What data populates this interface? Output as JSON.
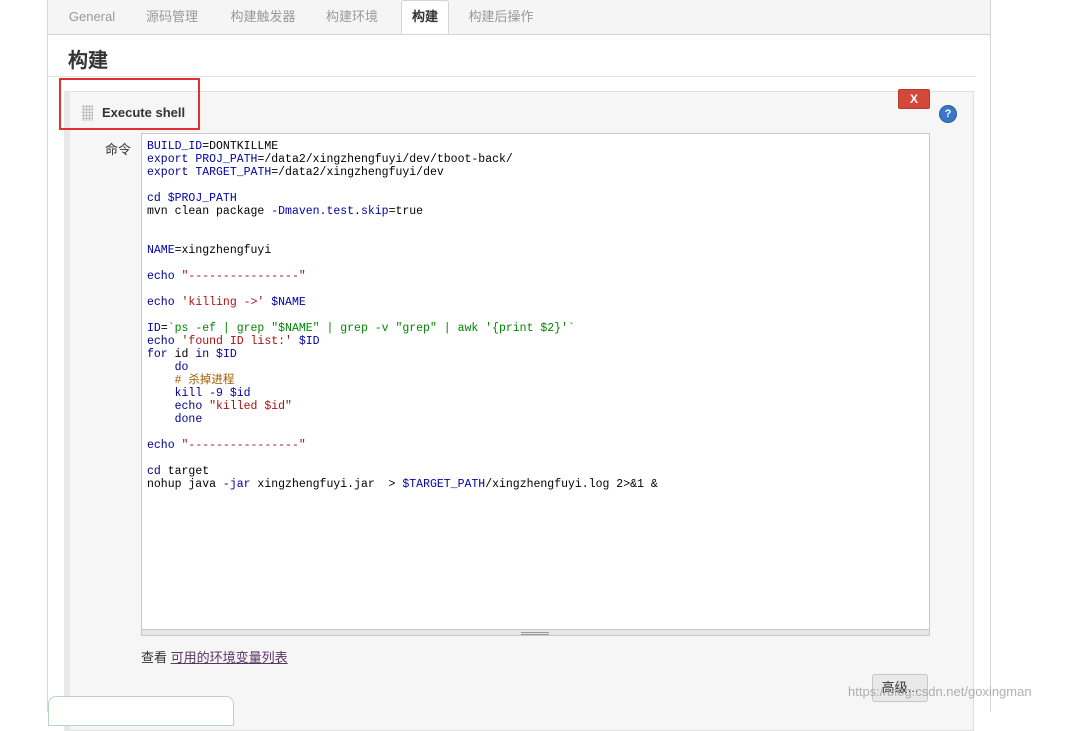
{
  "tabs": [
    {
      "label": "General"
    },
    {
      "label": "源码管理"
    },
    {
      "label": "构建触发器"
    },
    {
      "label": "构建环境"
    },
    {
      "label": "构建"
    },
    {
      "label": "构建后操作"
    }
  ],
  "active_tab": "构建",
  "section": {
    "title": "构建"
  },
  "step": {
    "title": "Execute shell",
    "delete_label": "X",
    "help_label": "?",
    "command_label": "命令",
    "command_lines": [
      "BUILD_ID=DONTKILLME",
      "export PROJ_PATH=/data2/xingzhengfuyi/dev/tboot-back/",
      "export TARGET_PATH=/data2/xingzhengfuyi/dev",
      "",
      "cd $PROJ_PATH",
      "mvn clean package -Dmaven.test.skip=true",
      "",
      "",
      "NAME=xingzhengfuyi",
      "",
      "echo \"----------------\"",
      "",
      "echo 'killing ->' $NAME",
      "",
      "ID=`ps -ef | grep \"$NAME\" | grep -v \"grep\" | awk '{print $2}'`",
      "echo 'found ID list:' $ID",
      "for id in $ID",
      "    do",
      "    # 杀掉进程",
      "    kill -9 $id",
      "    echo \"killed $id\"",
      "    done",
      "",
      "echo \"----------------\"",
      "",
      "cd target",
      "nohup java -jar xingzhengfuyi.jar  > $TARGET_PATH/xingzhengfuyi.log 2>&1 &"
    ],
    "env_prefix": "查看 ",
    "env_link": "可用的环境变量列表",
    "advanced_label": "高级..."
  },
  "watermark": "https://blog.csdn.net/goxingman",
  "colors": {
    "delete_button": "#d24939",
    "help_icon": "#3a77c8",
    "highlight": "#e03030",
    "link": "#5c3566"
  }
}
